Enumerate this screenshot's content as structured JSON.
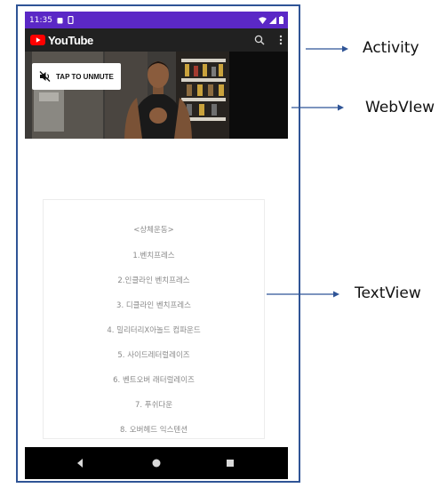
{
  "status_bar": {
    "time": "11:35",
    "colors": {
      "background": "#5b28c6"
    }
  },
  "toolbar": {
    "logo_text": "YouTube",
    "icons": [
      "youtube-play-icon",
      "search-icon",
      "more-vert-icon"
    ],
    "colors": {
      "background": "#212121",
      "logo_red": "#ff0000"
    }
  },
  "video": {
    "unmute_label": "TAP TO UNMUTE",
    "icons": [
      "muted-speaker-icon"
    ]
  },
  "text_view": {
    "lines": [
      "<상체운동>",
      "1.벤치프레스",
      "2.인클라인 벤치프레스",
      "3. 디클라인 벤치프레스",
      "4. 밀리터리X아놀드 컴파운드",
      "5. 사이드레터럴레이즈",
      "6. 벤트오버 래터럴레이즈",
      "7. 푸쉬다운",
      "8. 오버헤드 익스텐션"
    ]
  },
  "nav_bar": {
    "icons": [
      "back-triangle-icon",
      "home-circle-icon",
      "recents-square-icon"
    ]
  },
  "annotations": {
    "activity": "Activity",
    "webview": "WebVIew",
    "textview": "TextView",
    "colors": {
      "arrow": "#2f5496"
    }
  }
}
